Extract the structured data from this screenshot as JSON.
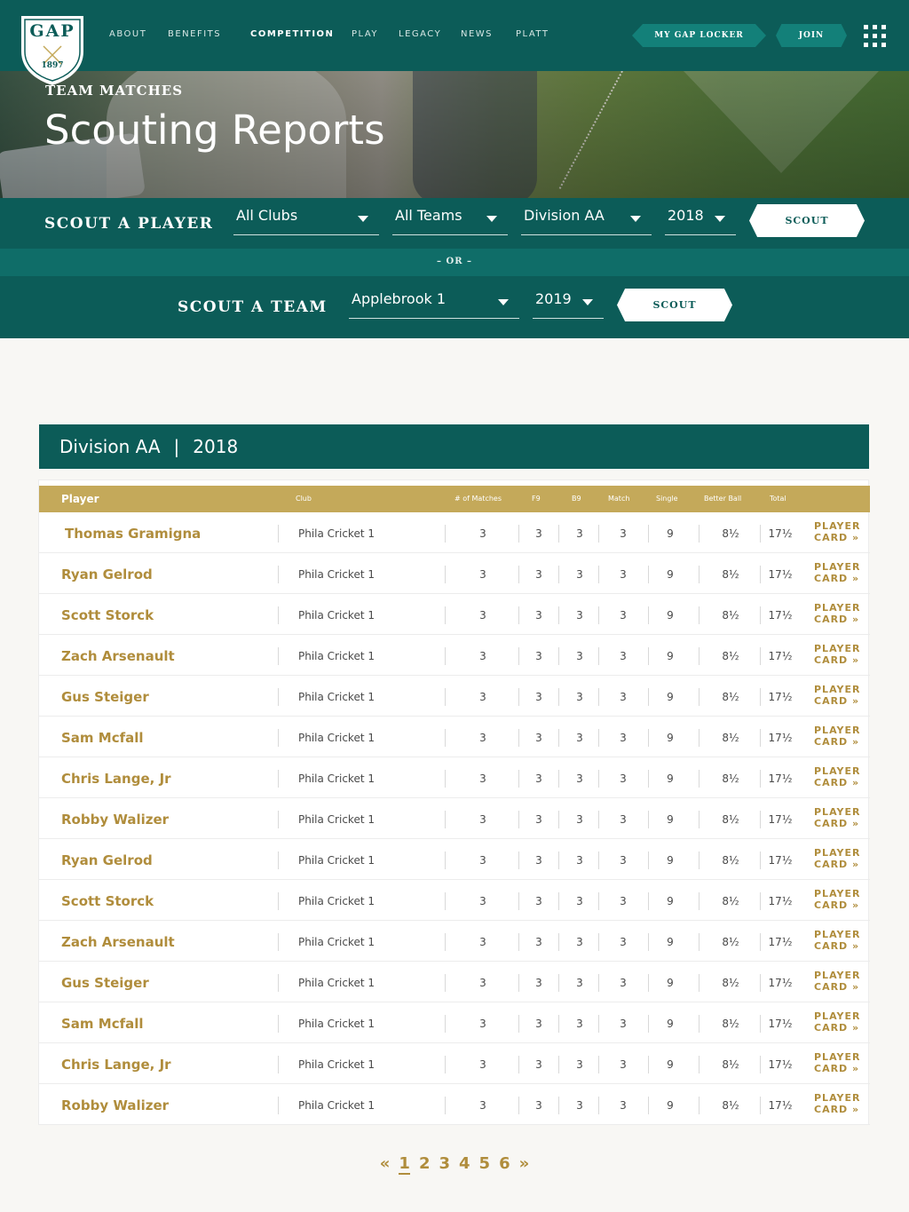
{
  "brand": {
    "logo_text": "GAP",
    "logo_year": "1897"
  },
  "nav": {
    "items": [
      {
        "label": "ABOUT"
      },
      {
        "label": "BENEFITS"
      },
      {
        "label": "COMPETITION"
      },
      {
        "label": "PLAY"
      },
      {
        "label": "LEGACY"
      },
      {
        "label": "NEWS"
      },
      {
        "label": "PLATT"
      }
    ],
    "locker_label": "MY GAP LOCKER",
    "join_label": "JOIN"
  },
  "hero": {
    "subtitle": "TEAM MATCHES",
    "title": "Scouting Reports"
  },
  "scout_player": {
    "label": "SCOUT A PLAYER",
    "club": "All Clubs",
    "team": "All Teams",
    "division": "Division AA",
    "year": "2018",
    "button": "SCOUT"
  },
  "or_text": "– OR –",
  "scout_team": {
    "label": "SCOUT A TEAM",
    "team": "Applebrook 1",
    "year": "2019",
    "button": "SCOUT"
  },
  "division_header": {
    "division": "Division AA",
    "separator": "|",
    "year": "2018"
  },
  "table": {
    "headers": {
      "player": "Player",
      "club": "Club",
      "matches": "# of Matches",
      "f9": "F9",
      "b9": "B9",
      "match": "Match",
      "single": "Single",
      "better_ball": "Better Ball",
      "total": "Total"
    },
    "card_line1": "PLAYER",
    "card_line2": "CARD »",
    "rows": [
      {
        "player": "Thomas Gramigna",
        "club": "Phila Cricket 1",
        "matches": "3",
        "f9": "3",
        "b9": "3",
        "match": "3",
        "single": "9",
        "better_ball": "8½",
        "total": "17½"
      },
      {
        "player": "Ryan Gelrod",
        "club": "Phila Cricket 1",
        "matches": "3",
        "f9": "3",
        "b9": "3",
        "match": "3",
        "single": "9",
        "better_ball": "8½",
        "total": "17½"
      },
      {
        "player": "Scott Storck",
        "club": "Phila Cricket 1",
        "matches": "3",
        "f9": "3",
        "b9": "3",
        "match": "3",
        "single": "9",
        "better_ball": "8½",
        "total": "17½"
      },
      {
        "player": "Zach Arsenault",
        "club": "Phila Cricket 1",
        "matches": "3",
        "f9": "3",
        "b9": "3",
        "match": "3",
        "single": "9",
        "better_ball": "8½",
        "total": "17½"
      },
      {
        "player": "Gus Steiger",
        "club": "Phila Cricket 1",
        "matches": "3",
        "f9": "3",
        "b9": "3",
        "match": "3",
        "single": "9",
        "better_ball": "8½",
        "total": "17½"
      },
      {
        "player": "Sam Mcfall",
        "club": "Phila Cricket 1",
        "matches": "3",
        "f9": "3",
        "b9": "3",
        "match": "3",
        "single": "9",
        "better_ball": "8½",
        "total": "17½"
      },
      {
        "player": "Chris Lange, Jr",
        "club": "Phila Cricket 1",
        "matches": "3",
        "f9": "3",
        "b9": "3",
        "match": "3",
        "single": "9",
        "better_ball": "8½",
        "total": "17½"
      },
      {
        "player": "Robby Walizer",
        "club": "Phila Cricket 1",
        "matches": "3",
        "f9": "3",
        "b9": "3",
        "match": "3",
        "single": "9",
        "better_ball": "8½",
        "total": "17½"
      },
      {
        "player": "Ryan Gelrod",
        "club": "Phila Cricket 1",
        "matches": "3",
        "f9": "3",
        "b9": "3",
        "match": "3",
        "single": "9",
        "better_ball": "8½",
        "total": "17½"
      },
      {
        "player": "Scott Storck",
        "club": "Phila Cricket 1",
        "matches": "3",
        "f9": "3",
        "b9": "3",
        "match": "3",
        "single": "9",
        "better_ball": "8½",
        "total": "17½"
      },
      {
        "player": "Zach Arsenault",
        "club": "Phila Cricket 1",
        "matches": "3",
        "f9": "3",
        "b9": "3",
        "match": "3",
        "single": "9",
        "better_ball": "8½",
        "total": "17½"
      },
      {
        "player": "Gus Steiger",
        "club": "Phila Cricket 1",
        "matches": "3",
        "f9": "3",
        "b9": "3",
        "match": "3",
        "single": "9",
        "better_ball": "8½",
        "total": "17½"
      },
      {
        "player": "Sam Mcfall",
        "club": "Phila Cricket 1",
        "matches": "3",
        "f9": "3",
        "b9": "3",
        "match": "3",
        "single": "9",
        "better_ball": "8½",
        "total": "17½"
      },
      {
        "player": "Chris Lange, Jr",
        "club": "Phila Cricket 1",
        "matches": "3",
        "f9": "3",
        "b9": "3",
        "match": "3",
        "single": "9",
        "better_ball": "8½",
        "total": "17½"
      },
      {
        "player": "Robby Walizer",
        "club": "Phila Cricket 1",
        "matches": "3",
        "f9": "3",
        "b9": "3",
        "match": "3",
        "single": "9",
        "better_ball": "8½",
        "total": "17½"
      }
    ]
  },
  "pagination": {
    "prev": "«",
    "pages": [
      "1",
      "2",
      "3",
      "4",
      "5",
      "6"
    ],
    "current": "1",
    "next": "»"
  },
  "colors": {
    "primary": "#0c5c58",
    "accent": "#138079",
    "gold": "#c4a95a",
    "gold_text": "#b08d3c"
  },
  "icons": {
    "menu": "grid-menu-icon",
    "caret": "caret-down-icon",
    "logo": "crossed-clubs-shield"
  }
}
